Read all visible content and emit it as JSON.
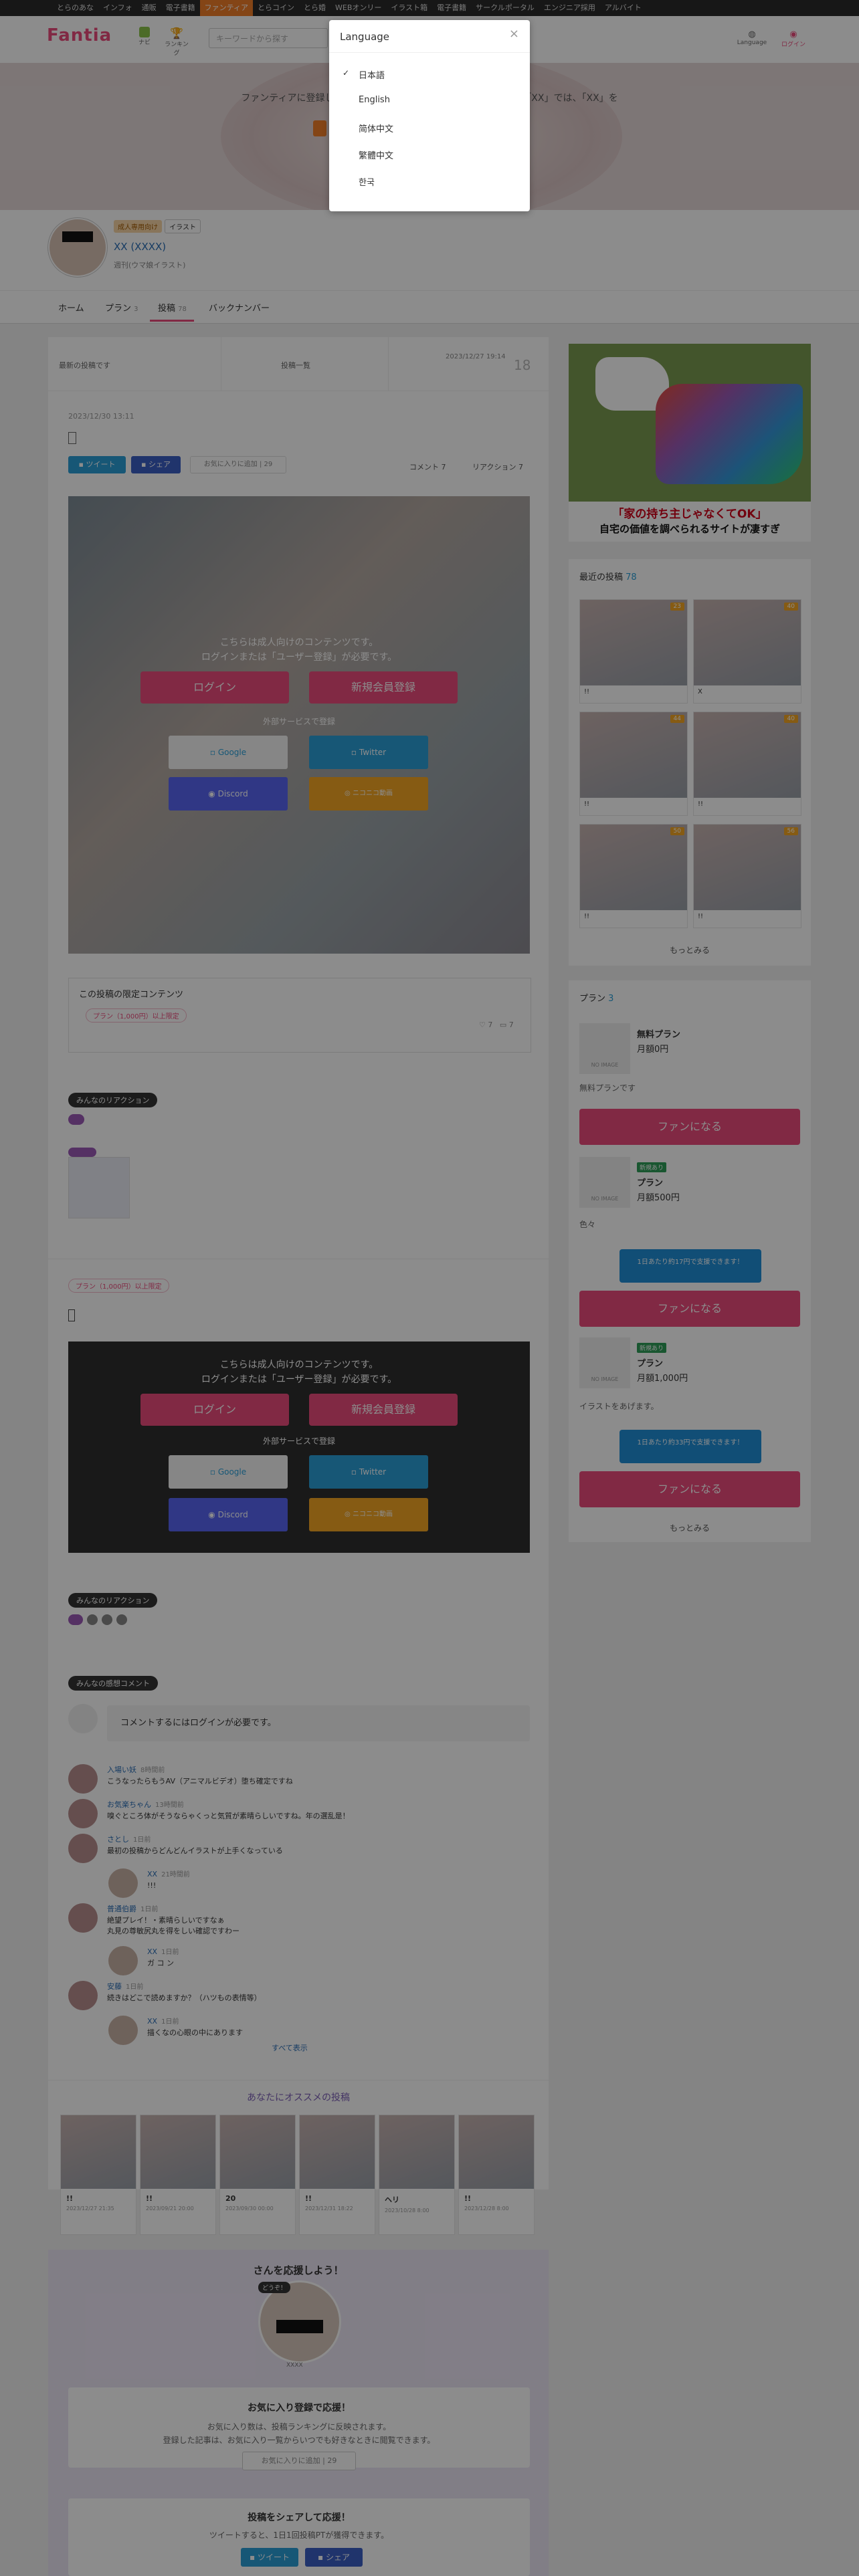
{
  "topnav": [
    "とらのあな",
    "インフォ",
    "通販",
    "電子書籍",
    "ファンティア",
    "とらコイン",
    "とら婚",
    "WEBオンリー",
    "イラスト箱",
    "電子書籍",
    "サークルポータル",
    "エンジニア採用",
    "アルバイト"
  ],
  "header": {
    "logo": "Fantia",
    "icons": [
      {
        "label": "ナビ"
      },
      {
        "label": "Notes"
      },
      {
        "label": "ランキング"
      }
    ],
    "search_placeholder": "キーワードから探す",
    "right_icons": [
      {
        "label": "Language"
      },
      {
        "label": "ログイン"
      }
    ]
  },
  "hero": {
    "text": "ファンティアに登録してXXさんを応援しよう!  さんのファンクラブ「XX」では、「XX」を"
  },
  "profile": {
    "badge_adult": "成人専用向け",
    "badge_cat": "イラスト",
    "name": "XX (XXXX)",
    "sub": "週刊(ウマ娘イラスト)"
  },
  "tabs": [
    {
      "label": "ホーム",
      "count": ""
    },
    {
      "label": "プラン",
      "count": "3"
    },
    {
      "label": "投稿",
      "count": "78"
    },
    {
      "label": "バックナンバー",
      "count": ""
    }
  ],
  "postnav": {
    "prev": "最新の投稿です",
    "list": "投稿一覧",
    "date": "2023/12/27 19:14",
    "likes": "18"
  },
  "post": {
    "date": "2023/12/30 13:11",
    "tweet": "ツイート",
    "share": "シェア",
    "fav": "お気に入りに追加 | 29",
    "comment": "コメント 7",
    "reaction": "リアクション 7",
    "gate_line1": "こちらは成人向けのコンテンツです。",
    "gate_line2": "ログインまたは「ユーザー登録」が必要です。",
    "login": "ログイン",
    "register": "新規会員登録",
    "external": "外部サービスで登録",
    "google": "Google",
    "twitter": "Twitter",
    "discord": "Discord",
    "other": "ニコニコ動画",
    "limited_title": "この投稿の限定コンテンツ",
    "limited_badge": "プラン（1,000円）以上限定",
    "reactions_title": "みんなのリアクション",
    "plan_badge": "プラン（1,000円）以上限定",
    "comments_title": "みんなの感想コメント",
    "comment_login": "コメントするにはログインが必要です。",
    "show_all": "すべて表示"
  },
  "comments": [
    {
      "name": "入場い妖",
      "time": "8時間前",
      "text": "こうなったらもうAV（アニマルビデオ）堕ち確定ですね",
      "reply": false
    },
    {
      "name": "お気楽ちゃん",
      "time": "13時間前",
      "text": "嗅ぐところ体がそうならゃくっと気質が素晴らしいですね。年の選乱是！",
      "reply": false
    },
    {
      "name": "さとし",
      "time": "1日前",
      "text": "最初の投稿からどんどんイラストが上手くなっている",
      "reply": false
    },
    {
      "name": "XX",
      "time": "21時間前",
      "text": "!!!",
      "reply": true
    },
    {
      "name": "普通伯爵",
      "time": "1日前",
      "text": "絶望プレイ！・素晴らしいですなぁ\n丸見の尊敏尻丸を得をしい確認ですわー",
      "reply": false
    },
    {
      "name": "XX",
      "time": "1日前",
      "text": "ガ コ ン",
      "reply": true
    },
    {
      "name": "安藤",
      "time": "1日前",
      "text": "続きはどこで読めますか？（ハツもの表情等）",
      "reply": false
    },
    {
      "name": "XX",
      "time": "1日前",
      "text": "描くなの心眼の中にあります",
      "reply": true
    }
  ],
  "recommend": {
    "title": "あなたにオススメの投稿",
    "items": [
      {
        "title": "!!",
        "date": "2023/12/27 21:35"
      },
      {
        "title": "!!",
        "date": "2023/09/21 20:00"
      },
      {
        "title": "20",
        "date": "2023/09/30 00:00"
      },
      {
        "title": "!!",
        "date": "2023/12/31 18:22"
      },
      {
        "title": "ヘリ",
        "date": "2023/10/28 8:00"
      },
      {
        "title": "!!",
        "date": "2023/12/28 8:00"
      }
    ]
  },
  "support": {
    "title": "さんを応援しよう！",
    "bubble": "どうぞ！",
    "name": "XXXX",
    "fav_title": "お気に入り登録で応援！",
    "fav_text1": "お気に入り数は、投稿ランキングに反映されます。",
    "fav_text2": "登録した記事は、お気に入り一覧からいつでも好きなときに閲覧できます。",
    "fav_btn": "お気に入りに追加 | 29",
    "share_title": "投稿をシェアして応援！",
    "share_text": "ツイートすると、1日1回投稿PTが獲得できます。",
    "tweet": "ツイート",
    "share": "シェア"
  },
  "sidebar": {
    "banner_caption1": "「家の持ち主じゃなくてOK」",
    "banner_caption2": "自宅の価値を調べられるサイトが凄すぎ",
    "recent_title": "最近の投稿",
    "recent_count": "78",
    "recent": [
      {
        "badge": "23",
        "title": "!!"
      },
      {
        "badge": "40",
        "title": "X"
      },
      {
        "badge": "44",
        "title": "!!"
      },
      {
        "badge": "40",
        "title": "!!"
      },
      {
        "badge": "50",
        "title": "!!"
      },
      {
        "badge": "56",
        "title": "!!"
      }
    ],
    "more": "もっとみる",
    "plans_title": "プラン",
    "plans_count": "3",
    "plans": [
      {
        "tag": "",
        "name": "無料プラン",
        "price": "月額0円",
        "desc": "無料プランです",
        "promo": "",
        "btn": "ファンになる"
      },
      {
        "tag": "新規あり",
        "name": "プラン",
        "price": "月額500円",
        "desc": "色々",
        "promo": "1日あたり約17円で支援できます！",
        "btn": "ファンになる"
      },
      {
        "tag": "新規あり",
        "name": "プラン",
        "price": "月額1,000円",
        "desc": "イラストをあげます。",
        "promo": "1日あたり約33円で支援できます！",
        "btn": "ファンになる"
      }
    ],
    "no_image": "NO IMAGE",
    "more2": "もっとみる"
  },
  "language": {
    "title": "Language",
    "options": [
      {
        "label": "日本語",
        "selected": true
      },
      {
        "label": "English",
        "selected": false
      },
      {
        "label": "简体中文",
        "selected": false
      },
      {
        "label": "繁體中文",
        "selected": false
      },
      {
        "label": "한국",
        "selected": false
      }
    ],
    "close": "×"
  }
}
